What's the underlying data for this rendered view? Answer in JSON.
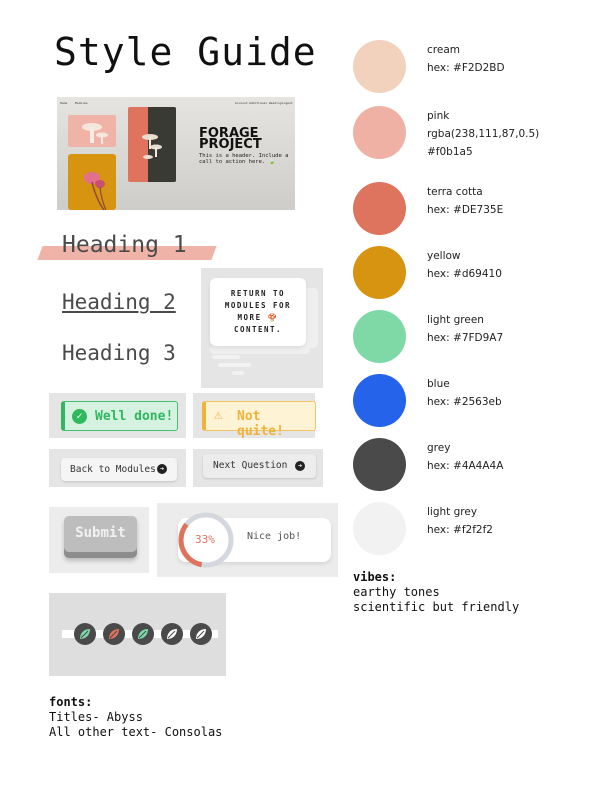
{
  "page_title": "Style Guide",
  "header_preview": {
    "nav_left": [
      "Home",
      "Modules"
    ],
    "nav_right": [
      "Account",
      "Additional Reading",
      "Logout"
    ],
    "project_title_line1": "FORAGE",
    "project_title_line2": "PROJECT",
    "subtitle": "This is a header. Include a call to action here. 🍃"
  },
  "headings": {
    "h1": "Heading 1",
    "h2": "Heading 2",
    "h3": "Heading 3"
  },
  "return_card": {
    "line1": "RETURN TO",
    "line2": "MODULES FOR",
    "line3": "MORE 🍄",
    "line4": "CONTENT."
  },
  "alerts": {
    "success": "Well done!",
    "warning": "Not quite!"
  },
  "buttons": {
    "back": "Back to Modules",
    "next": "Next Question",
    "submit": "Submit"
  },
  "progress": {
    "percent_label": "33%",
    "value": 0.33,
    "message": "Nice job!"
  },
  "palette": [
    {
      "name": "cream",
      "lines": [
        "cream",
        "hex: #F2D2BD"
      ],
      "color": "#F2D2BD"
    },
    {
      "name": "pink",
      "lines": [
        "pink",
        "rgba(238,111,87,0.5)",
        "#f0b1a5"
      ],
      "color": "#f0b1a5"
    },
    {
      "name": "terra cotta",
      "lines": [
        "terra cotta",
        "hex: #DE735E"
      ],
      "color": "#DE735E"
    },
    {
      "name": "yellow",
      "lines": [
        "yellow",
        "hex: #d69410"
      ],
      "color": "#d69410"
    },
    {
      "name": "light green",
      "lines": [
        "light green",
        "hex: #7FD9A7"
      ],
      "color": "#7FD9A7"
    },
    {
      "name": "blue",
      "lines": [
        "blue",
        "hex: #2563eb"
      ],
      "color": "#2563eb"
    },
    {
      "name": "grey",
      "lines": [
        "grey",
        "hex: #4A4A4A"
      ],
      "color": "#4A4A4A"
    },
    {
      "name": "light grey",
      "lines": [
        "light grey",
        "hex: #f2f2f2"
      ],
      "color": "#f2f2f2"
    }
  ],
  "vibes": {
    "label": "vibes",
    "lines": [
      "earthy tones",
      "scientific but friendly"
    ]
  },
  "fonts": {
    "label": "fonts",
    "lines": [
      "Titles- Abyss",
      "All other text- Consolas"
    ]
  },
  "leaf_stepper": {
    "steps": [
      {
        "state": "complete",
        "leaf_color": "#7FD9A7"
      },
      {
        "state": "current",
        "leaf_color": "#DE735E"
      },
      {
        "state": "complete",
        "leaf_color": "#7FD9A7"
      },
      {
        "state": "upcoming",
        "leaf_color": "#ffffff"
      },
      {
        "state": "upcoming",
        "leaf_color": "#ffffff"
      }
    ]
  }
}
